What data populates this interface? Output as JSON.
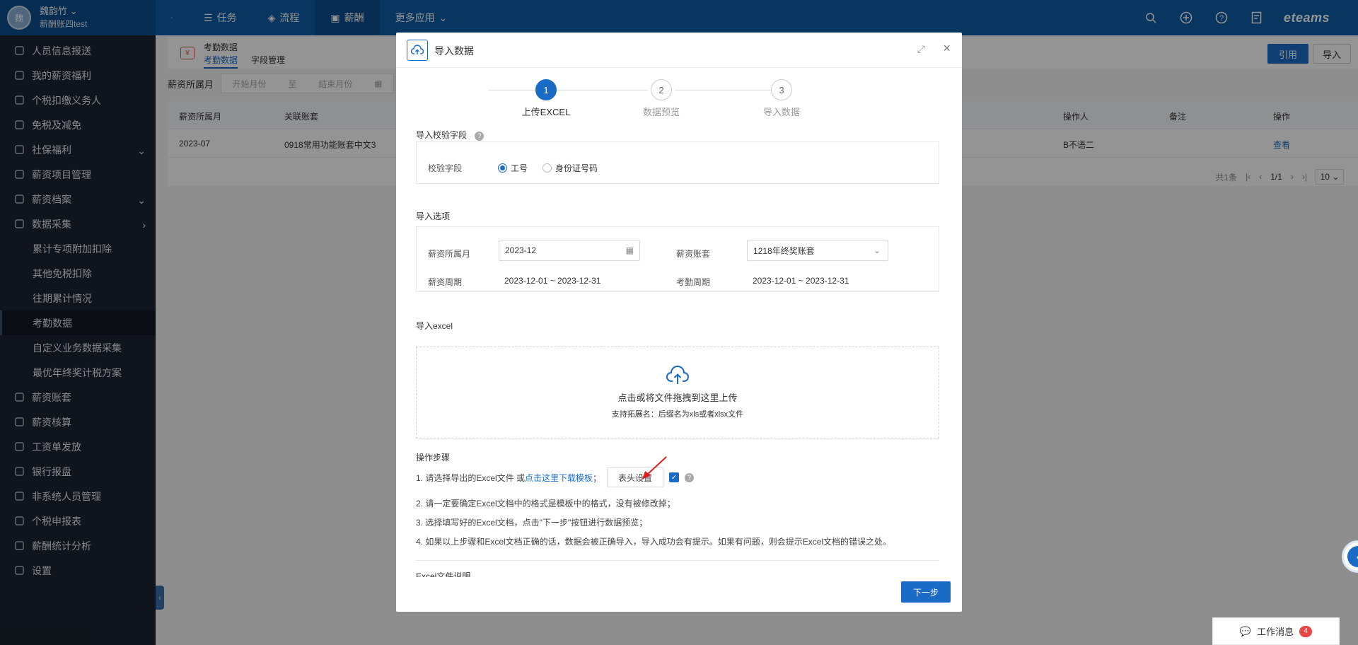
{
  "user": {
    "avatar_text": "魏",
    "name": "魏韵竹",
    "tenant": "薪酬账四test"
  },
  "nav": {
    "items": [
      {
        "label": "任务"
      },
      {
        "label": "流程"
      },
      {
        "label": "薪酬"
      },
      {
        "label": "更多应用"
      }
    ],
    "active": "薪酬"
  },
  "brand": "eteams",
  "sidebar": {
    "items": [
      {
        "label": "人员信息报送",
        "icon": "person-report-icon"
      },
      {
        "label": "我的薪资福利",
        "icon": "wallet-icon"
      },
      {
        "label": "个税扣缴义务人",
        "icon": "person-icon"
      },
      {
        "label": "免税及减免",
        "icon": "wallet-icon"
      },
      {
        "label": "社保福利",
        "icon": "shield-icon",
        "expand": "down"
      },
      {
        "label": "薪资项目管理",
        "icon": "project-icon"
      },
      {
        "label": "薪资档案",
        "icon": "archive-icon",
        "expand": "down"
      },
      {
        "label": "数据采集",
        "icon": "collect-icon",
        "expand": "right"
      },
      {
        "label": "累计专项附加扣除",
        "sub": true
      },
      {
        "label": "其他免税扣除",
        "sub": true
      },
      {
        "label": "往期累计情况",
        "sub": true
      },
      {
        "label": "考勤数据",
        "sub": true,
        "active": true
      },
      {
        "label": "自定义业务数据采集",
        "sub": true
      },
      {
        "label": "最优年终奖计税方案",
        "sub": true
      },
      {
        "label": "薪资账套",
        "icon": "ledger-icon"
      },
      {
        "label": "薪资核算",
        "icon": "calc-icon"
      },
      {
        "label": "工资单发放",
        "icon": "payslip-icon"
      },
      {
        "label": "银行报盘",
        "icon": "bank-icon"
      },
      {
        "label": "非系统人员管理",
        "icon": "person-icon"
      },
      {
        "label": "个税申报表",
        "icon": "tax-icon"
      },
      {
        "label": "薪酬统计分析",
        "icon": "chart-icon"
      },
      {
        "label": "设置",
        "icon": "gear-icon"
      }
    ]
  },
  "page": {
    "title": "考勤数据",
    "tabs": [
      "考勤数据",
      "字段管理"
    ],
    "btn_cite": "引用",
    "btn_import": "导入",
    "filter_label": "薪资所属月",
    "filter_start": "开始月份",
    "filter_sep": "至",
    "filter_end": "结束月份"
  },
  "table": {
    "headers": [
      "薪资所属月",
      "关联账套",
      "操作人",
      "备注",
      "操作"
    ],
    "row": {
      "month": "2023-07",
      "ledger": "0918常用功能账套中文3",
      "operator": "B不语二",
      "remark": "",
      "action": "查看"
    }
  },
  "pager": {
    "total": "共1条",
    "page": "1/1",
    "size": "10"
  },
  "modal": {
    "title": "导入数据",
    "steps": [
      {
        "num": "1",
        "label": "上传EXCEL"
      },
      {
        "num": "2",
        "label": "数据预览"
      },
      {
        "num": "3",
        "label": "导入数据"
      }
    ],
    "active_step": 1,
    "verify_title": "导入校验字段",
    "verify_label": "校验字段",
    "verify_options": [
      "工号",
      "身份证号码"
    ],
    "verify_selected": "工号",
    "options_title": "导入选项",
    "salary_month_label": "薪资所属月",
    "salary_month_value": "2023-12",
    "ledger_label": "薪资账套",
    "ledger_value": "1218年终奖账套",
    "salary_period_label": "薪资周期",
    "salary_period_value": "2023-12-01 ~ 2023-12-31",
    "attend_period_label": "考勤周期",
    "attend_period_value": "2023-12-01 ~ 2023-12-31",
    "excel_title": "导入excel",
    "upload_text": "点击或将文件拖拽到这里上传",
    "upload_hint": "支持拓展名：后缀名为xls或者xlsx文件",
    "steps_title": "操作步骤",
    "step1_prefix": "1. 请选择导出的Excel文件 或 ",
    "step1_link": "点击这里下载模板",
    "step1_suffix": "；",
    "header_btn": "表头设置",
    "step2": "2. 请一定要确定Excel文档中的格式是模板中的格式，没有被修改掉；",
    "step3": "3. 选择填写好的Excel文档，点击\"下一步\"按钮进行数据预览；",
    "step4": "4. 如果以上步骤和Excel文档正确的话，数据会被正确导入，导入成功会有提示。如果有问题，则会提示Excel文档的错误之处。",
    "excel_desc_title": "Excel文件说明",
    "next_btn": "下一步"
  },
  "workmsg": {
    "label": "工作消息",
    "count": "4"
  },
  "colors": {
    "primary": "#1a6bc6",
    "topbar": "#0f5ea8",
    "sidebar": "#1c2431",
    "badge": "#e84545"
  }
}
